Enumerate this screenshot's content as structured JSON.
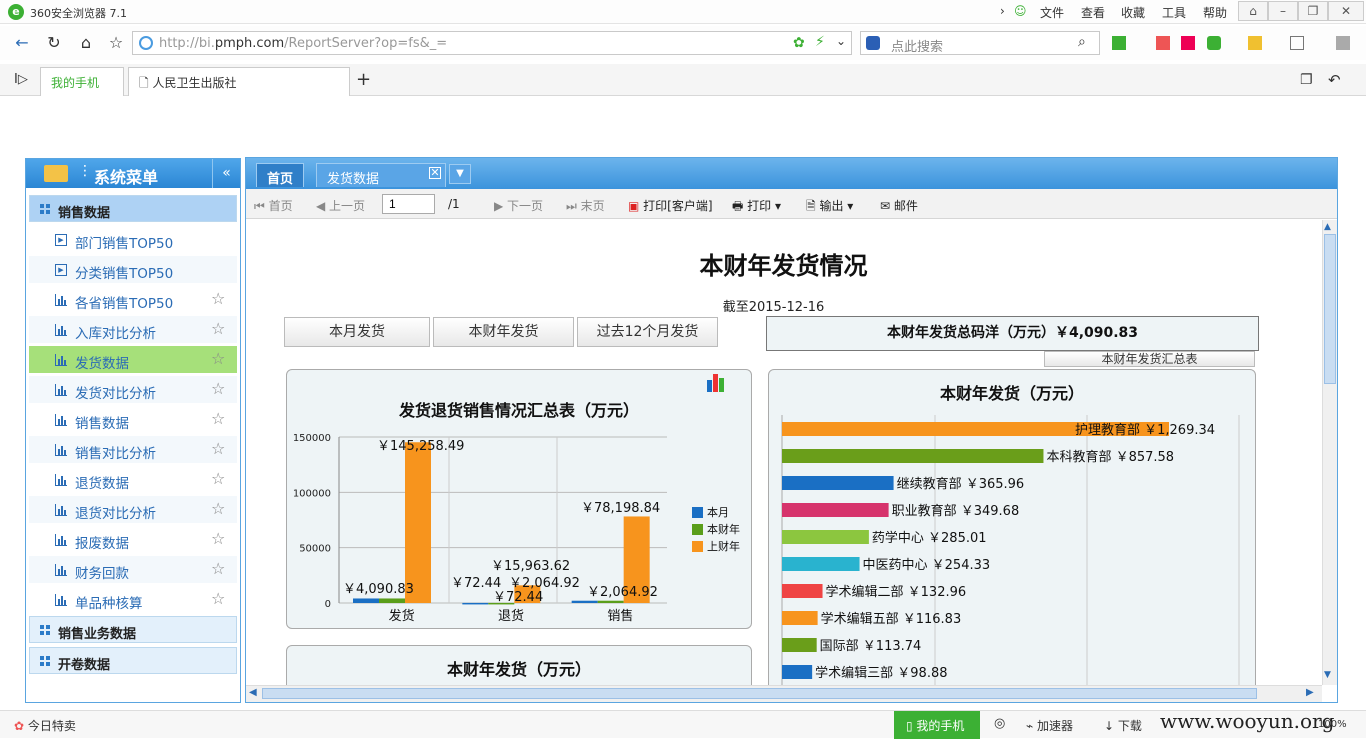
{
  "browser": {
    "title": "360安全浏览器 7.1",
    "menu": [
      "文件",
      "查看",
      "收藏",
      "工具",
      "帮助"
    ],
    "url_prefix": "http://bi.",
    "url_domain": "pmph.com",
    "url_suffix": "/ReportServer?op=fs&_=",
    "search_placeholder": "点此搜索",
    "tabs": [
      "我的手机",
      "人民卫生出版社"
    ]
  },
  "sidebar": {
    "title": "系统菜单",
    "group1": "销售数据",
    "items": [
      "部门销售TOP50",
      "分类销售TOP50",
      "各省销售TOP50",
      "入库对比分析",
      "发货数据",
      "发货对比分析",
      "销售数据",
      "销售对比分析",
      "退货数据",
      "退货对比分析",
      "报废数据",
      "财务回款",
      "单品种核算"
    ],
    "group2": "销售业务数据",
    "group3": "开卷数据"
  },
  "content": {
    "tabs": [
      "首页",
      "发货数据"
    ],
    "toolbar": {
      "first": "首页",
      "prev": "上一页",
      "page": "1",
      "total": "/1",
      "next": "下一页",
      "last": "末页",
      "print_client": "打印[客户端]",
      "print": "打印",
      "export": "输出",
      "mail": "邮件"
    },
    "report": {
      "title": "本财年发货情况",
      "date": "截至2015-12-16",
      "buttons": [
        "本月发货",
        "本财年发货",
        "过去12个月发货"
      ],
      "total_label": "本财年发货总码洋（万元）￥4,090.83",
      "summary_button": "本财年发货汇总表",
      "panel_bottom_title": "本财年发货（万元）"
    }
  },
  "statusbar": {
    "left": "今日特卖",
    "mobile": "我的手机",
    "accel": "加速器",
    "download": "下载",
    "zoom": "100%",
    "watermark": "www.wooyun.org"
  },
  "chart_data": [
    {
      "type": "bar",
      "title": "发货退货销售情况汇总表（万元）",
      "categories": [
        "发货",
        "退货",
        "销售"
      ],
      "series": [
        {
          "name": "本月",
          "color": "#1a6fc4",
          "values": [
            4090.83,
            72.44,
            2064.92
          ]
        },
        {
          "name": "本财年",
          "color": "#5a9e1a",
          "values": [
            4090.83,
            72.44,
            2064.92
          ]
        },
        {
          "name": "上财年",
          "color": "#f7941d",
          "values": [
            145258.49,
            15963.62,
            78198.84
          ]
        }
      ],
      "value_labels": {
        "发货": [
          "￥4,090.83",
          "￥145,258.49"
        ],
        "退货": [
          "￥72.44",
          "￥72.44",
          "￥2,064.92",
          "￥15,963.62"
        ],
        "销售": [
          "￥2,064.92",
          "￥78,198.84"
        ]
      },
      "y_ticks": [
        "0",
        "50000",
        "100000",
        "150000"
      ],
      "ylim": [
        0,
        150000
      ],
      "legend": "right"
    },
    {
      "type": "bar",
      "orientation": "horizontal",
      "title": "本财年发货（万元）",
      "categories": [
        "护理教育部",
        "本科教育部",
        "继续教育部",
        "职业教育部",
        "药学中心",
        "中医药中心",
        "学术编辑二部",
        "学术编辑五部",
        "国际部",
        "学术编辑三部"
      ],
      "values": [
        1269.34,
        857.58,
        365.96,
        349.68,
        285.01,
        254.33,
        132.96,
        116.83,
        113.74,
        98.88
      ],
      "labels": [
        "￥1,269.34",
        "￥857.58",
        "￥365.96",
        "￥349.68",
        "￥285.01",
        "￥254.33",
        "￥132.96",
        "￥116.83",
        "￥113.74",
        "￥98.88"
      ],
      "colors": [
        "#f7941d",
        "#6a9e1a",
        "#1a6fc4",
        "#d6336c",
        "#8cc63f",
        "#29b3cf",
        "#ef4444",
        "#f7941d",
        "#6a9e1a",
        "#1a6fc4"
      ]
    }
  ]
}
